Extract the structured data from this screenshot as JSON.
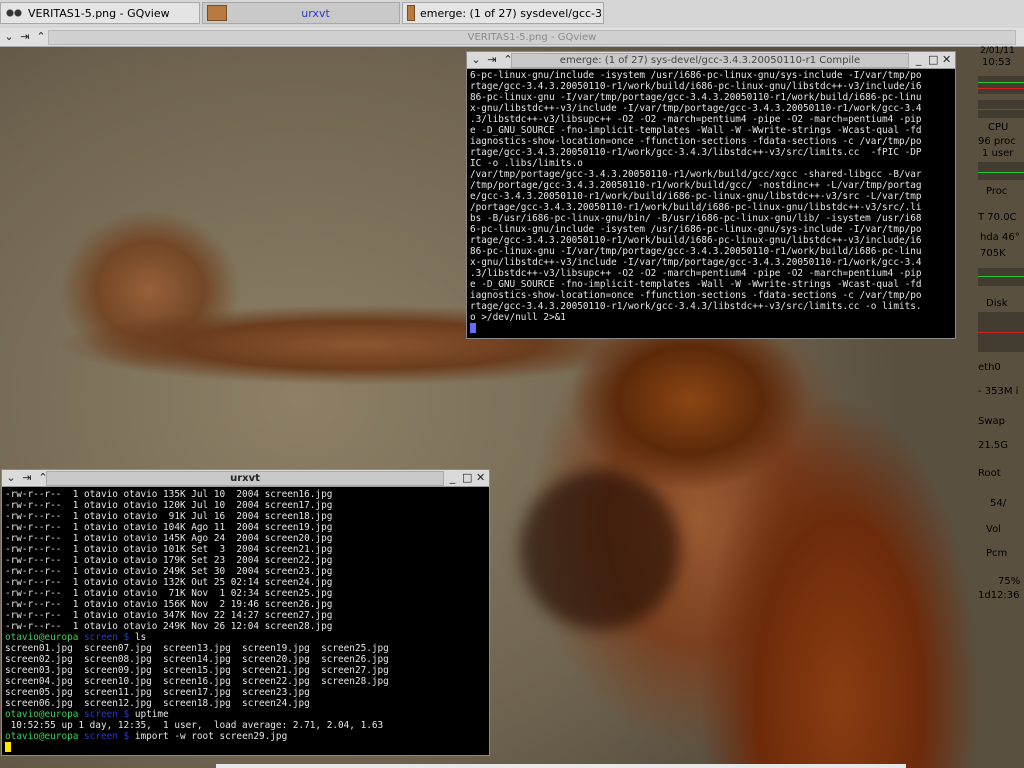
{
  "taskbar": {
    "tasks": [
      {
        "label": "VERITAS1-5.png - GQview",
        "icon": "glasses-icon"
      },
      {
        "label": "urxvt",
        "icon": "terminal-icon"
      },
      {
        "label": "emerge: (1 of 27) sysdevel/gcc-3.4.3.",
        "icon": "terminal-icon"
      }
    ]
  },
  "gqview": {
    "title": "VERITAS1-5.png - GQview"
  },
  "emerge_window": {
    "title": "emerge: (1 of 27) sys-devel/gcc-3.4.3.20050110-r1 Compile",
    "output": "6-pc-linux-gnu/include -isystem /usr/i686-pc-linux-gnu/sys-include -I/var/tmp/po\nrtage/gcc-3.4.3.20050110-r1/work/build/i686-pc-linux-gnu/libstdc++-v3/include/i6\n86-pc-linux-gnu -I/var/tmp/portage/gcc-3.4.3.20050110-r1/work/build/i686-pc-linu\nx-gnu/libstdc++-v3/include -I/var/tmp/portage/gcc-3.4.3.20050110-r1/work/gcc-3.4\n.3/libstdc++-v3/libsupc++ -O2 -O2 -march=pentium4 -pipe -O2 -march=pentium4 -pip\ne -D_GNU_SOURCE -fno-implicit-templates -Wall -W -Wwrite-strings -Wcast-qual -fd\niagnostics-show-location=once -ffunction-sections -fdata-sections -c /var/tmp/po\nrtage/gcc-3.4.3.20050110-r1/work/gcc-3.4.3/libstdc++-v3/src/limits.cc  -fPIC -DP\nIC -o .libs/limits.o\n/var/tmp/portage/gcc-3.4.3.20050110-r1/work/build/gcc/xgcc -shared-libgcc -B/var\n/tmp/portage/gcc-3.4.3.20050110-r1/work/build/gcc/ -nostdinc++ -L/var/tmp/portag\ne/gcc-3.4.3.20050110-r1/work/build/i686-pc-linux-gnu/libstdc++-v3/src -L/var/tmp\n/portage/gcc-3.4.3.20050110-r1/work/build/i686-pc-linux-gnu/libstdc++-v3/src/.li\nbs -B/usr/i686-pc-linux-gnu/bin/ -B/usr/i686-pc-linux-gnu/lib/ -isystem /usr/i68\n6-pc-linux-gnu/include -isystem /usr/i686-pc-linux-gnu/sys-include -I/var/tmp/po\nrtage/gcc-3.4.3.20050110-r1/work/build/i686-pc-linux-gnu/libstdc++-v3/include/i6\n86-pc-linux-gnu -I/var/tmp/portage/gcc-3.4.3.20050110-r1/work/build/i686-pc-linu\nx-gnu/libstdc++-v3/include -I/var/tmp/portage/gcc-3.4.3.20050110-r1/work/gcc-3.4\n.3/libstdc++-v3/libsupc++ -O2 -O2 -march=pentium4 -pipe -O2 -march=pentium4 -pip\ne -D_GNU_SOURCE -fno-implicit-templates -Wall -W -Wwrite-strings -Wcast-qual -fd\niagnostics-show-location=once -ffunction-sections -fdata-sections -c /var/tmp/po\nrtage/gcc-3.4.3.20050110-r1/work/gcc-3.4.3/libstdc++-v3/src/limits.cc -o limits.\no >/dev/null 2>&1"
  },
  "urxvt_window": {
    "title": "urxvt",
    "listing": "-rw-r--r--  1 otavio otavio 135K Jul 10  2004 screen16.jpg\n-rw-r--r--  1 otavio otavio 120K Jul 10  2004 screen17.jpg\n-rw-r--r--  1 otavio otavio  91K Jul 16  2004 screen18.jpg\n-rw-r--r--  1 otavio otavio 104K Ago 11  2004 screen19.jpg\n-rw-r--r--  1 otavio otavio 145K Ago 24  2004 screen20.jpg\n-rw-r--r--  1 otavio otavio 101K Set  3  2004 screen21.jpg\n-rw-r--r--  1 otavio otavio 179K Set 23  2004 screen22.jpg\n-rw-r--r--  1 otavio otavio 249K Set 30  2004 screen23.jpg\n-rw-r--r--  1 otavio otavio 132K Out 25 02:14 screen24.jpg\n-rw-r--r--  1 otavio otavio  71K Nov  1 02:34 screen25.jpg\n-rw-r--r--  1 otavio otavio 156K Nov  2 19:46 screen26.jpg\n-rw-r--r--  1 otavio otavio 347K Nov 22 14:27 screen27.jpg\n-rw-r--r--  1 otavio otavio 249K Nov 26 12:04 screen28.jpg",
    "prompt_user": "otavio@europa",
    "prompt_dir": "screen $",
    "cmd_ls": " ls",
    "ls_output": "screen01.jpg  screen07.jpg  screen13.jpg  screen19.jpg  screen25.jpg\nscreen02.jpg  screen08.jpg  screen14.jpg  screen20.jpg  screen26.jpg\nscreen03.jpg  screen09.jpg  screen15.jpg  screen21.jpg  screen27.jpg\nscreen04.jpg  screen10.jpg  screen16.jpg  screen22.jpg  screen28.jpg\nscreen05.jpg  screen11.jpg  screen17.jpg  screen23.jpg\nscreen06.jpg  screen12.jpg  screen18.jpg  screen24.jpg",
    "cmd_uptime": " uptime",
    "uptime_output": " 10:52:55 up 1 day, 12:35,  1 user,  load average: 2.71, 2.04, 1.63",
    "cmd_import": " import -w root screen29.jpg"
  },
  "monitor": {
    "date": "2/01/11",
    "time": "10:53",
    "cpu_label": "CPU",
    "procs": "96 proc",
    "users": "1 user",
    "proc_label": "Proc",
    "temp": "T 70.0C",
    "hda": "hda 46°",
    "mem": "705K",
    "disk_label": "Disk",
    "eth_label": "eth0",
    "eth_value": "- 353M i",
    "swap_label": "Swap",
    "swap_value": "21.5G",
    "root_label": "Root",
    "root_value": "54/",
    "vol_label": "Vol",
    "pcm_label": "Pcm",
    "pcm_value": "75%",
    "uptime_value": "1d12:36"
  },
  "colors": {
    "prompt_user": "#39d05a",
    "prompt_dir": "#2a39c8",
    "cursor_emerge": "#6a6aff",
    "cursor_urxvt": "#ffe600",
    "graph_green": "#22c83c",
    "graph_red": "#d02020"
  }
}
